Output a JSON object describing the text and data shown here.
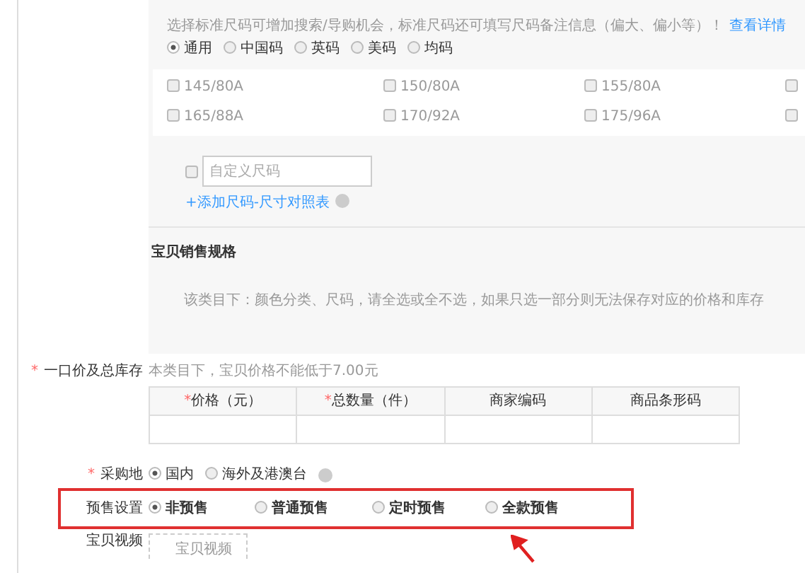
{
  "size_section": {
    "hint": "选择标准尺码可增加搜索/导购机会，标准尺码还可填写尺码备注信息（偏大、偏小等）！",
    "hint_link": "查看详情",
    "size_systems": [
      {
        "label": "通用",
        "selected": true
      },
      {
        "label": "中国码",
        "selected": false
      },
      {
        "label": "英码",
        "selected": false
      },
      {
        "label": "美码",
        "selected": false
      },
      {
        "label": "均码",
        "selected": false
      }
    ],
    "sizes": [
      {
        "label": "145/80A",
        "checked": false
      },
      {
        "label": "150/80A",
        "checked": false
      },
      {
        "label": "155/80A",
        "checked": false
      },
      {
        "checked": false
      },
      {
        "label": "165/88A",
        "checked": false
      },
      {
        "label": "170/92A",
        "checked": false
      },
      {
        "label": "175/96A",
        "checked": false
      },
      {
        "checked": false
      }
    ],
    "custom_size": {
      "checked": false,
      "placeholder": "自定义尺码"
    },
    "add_link": "+添加尺码-尺寸对照表"
  },
  "sales_spec": {
    "title": "宝贝销售规格",
    "hint": "该类目下：颜色分类、尺码，请全选或全不选，如果只选一部分则无法保存对应的价格和库存"
  },
  "price_stock": {
    "required_mark": "*",
    "label": "一口价及总库存",
    "hint": "本类目下，宝贝价格不能低于7.00元",
    "columns": [
      {
        "required_mark": "*",
        "label": "价格（元）"
      },
      {
        "required_mark": "*",
        "label": "总数量（件）"
      },
      {
        "label": "商家编码"
      },
      {
        "label": "商品条形码"
      }
    ]
  },
  "purchase_place": {
    "required_mark": "*",
    "label": "采购地",
    "options": [
      {
        "label": "国内",
        "selected": true
      },
      {
        "label": "海外及港澳台",
        "selected": false
      }
    ]
  },
  "presale": {
    "label": "预售设置",
    "highlighted": true,
    "options": [
      {
        "label": "非预售",
        "selected": true
      },
      {
        "label": "普通预售",
        "selected": false
      },
      {
        "label": "定时预售",
        "selected": false
      },
      {
        "label": "全款预售",
        "selected": false
      }
    ]
  },
  "video": {
    "label": "宝贝视频",
    "box_text": "宝贝视频"
  }
}
